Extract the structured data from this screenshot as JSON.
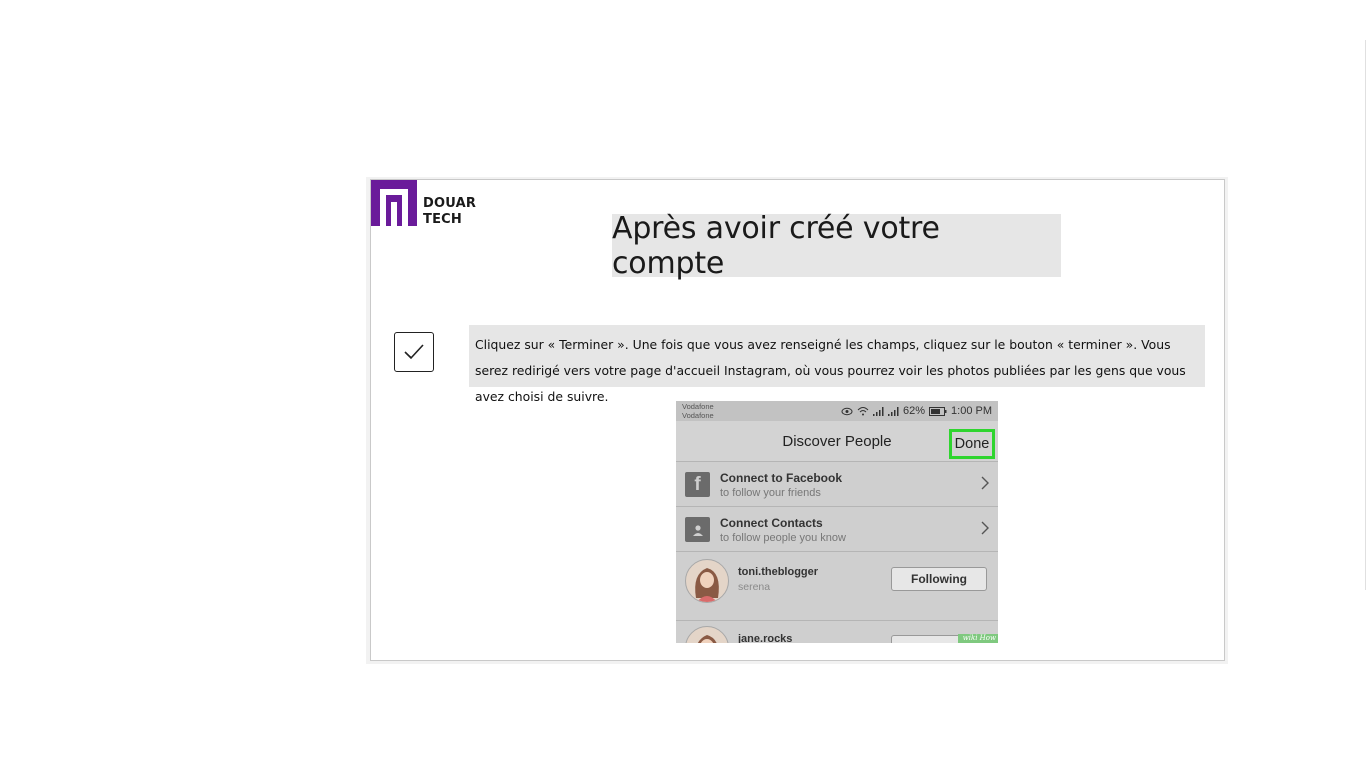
{
  "logo": {
    "line1": "DOUAR",
    "line2": "TECH",
    "color": "#6a1b9a"
  },
  "slide": {
    "title": "Après avoir créé votre compte",
    "step_text": "Cliquez sur « Terminer ». Une fois que vous avez renseigné les champs, cliquez sur le bouton « terminer ». Vous serez redirigé vers votre page d'accueil Instagram, où vous pourrez voir les photos publiées par les gens que vous avez choisi de suivre.",
    "check_icon": "checkmark-icon"
  },
  "phone": {
    "status": {
      "carrier_line1": "Vodafone",
      "carrier_line2": "Vodafone",
      "battery": "62%",
      "time": "1:00 PM"
    },
    "nav": {
      "title": "Discover People",
      "done_label": "Done",
      "highlight_color": "#2fd52f"
    },
    "rows": [
      {
        "title": "Connect to Facebook",
        "subtitle": "to follow your friends",
        "icon": "facebook-icon"
      },
      {
        "title": "Connect Contacts",
        "subtitle": "to follow people you know",
        "icon": "contact-icon"
      }
    ],
    "users": [
      {
        "name": "toni.theblogger",
        "subtitle": "serena",
        "button": "Following"
      },
      {
        "name": "jane.rocks",
        "subtitle": "",
        "button": ""
      }
    ],
    "watermark": "wiki How"
  }
}
